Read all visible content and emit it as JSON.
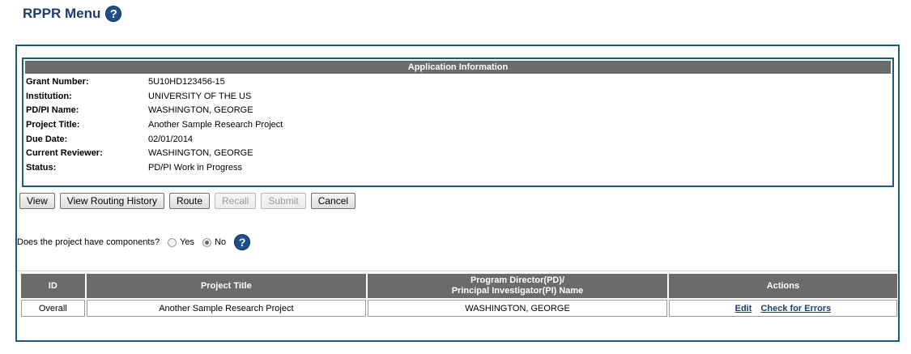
{
  "page": {
    "title": "RPPR Menu"
  },
  "app_info": {
    "header": "Application Information",
    "rows": [
      {
        "label": "Grant Number:",
        "value": "5U10HD123456-15"
      },
      {
        "label": "Institution:",
        "value": "UNIVERSITY OF THE US"
      },
      {
        "label": "PD/PI Name:",
        "value": "WASHINGTON, GEORGE"
      },
      {
        "label": "Project Title:",
        "value": "Another Sample Research Project"
      },
      {
        "label": "Due Date:",
        "value": "02/01/2014"
      },
      {
        "label": "Current Reviewer:",
        "value": "WASHINGTON, GEORGE"
      },
      {
        "label": "Status:",
        "value": "PD/PI Work in Progress"
      }
    ]
  },
  "buttons": {
    "view": "View",
    "view_routing_history": "View Routing History",
    "route": "Route",
    "recall": "Recall",
    "submit": "Submit",
    "cancel": "Cancel"
  },
  "components": {
    "question": "Does the project have components?",
    "yes": "Yes",
    "no": "No",
    "selected": "No"
  },
  "table": {
    "headers": {
      "id": "ID",
      "project_title": "Project Title",
      "pd_pi_line1": "Program Director(PD)/",
      "pd_pi_line2": "Principal Investigator(PI) Name",
      "actions": "Actions"
    },
    "rows": [
      {
        "id": "Overall",
        "project_title": "Another Sample Research Project",
        "pd_pi": "WASHINGTON, GEORGE",
        "action_edit": "Edit",
        "action_check": "Check for Errors"
      }
    ]
  }
}
